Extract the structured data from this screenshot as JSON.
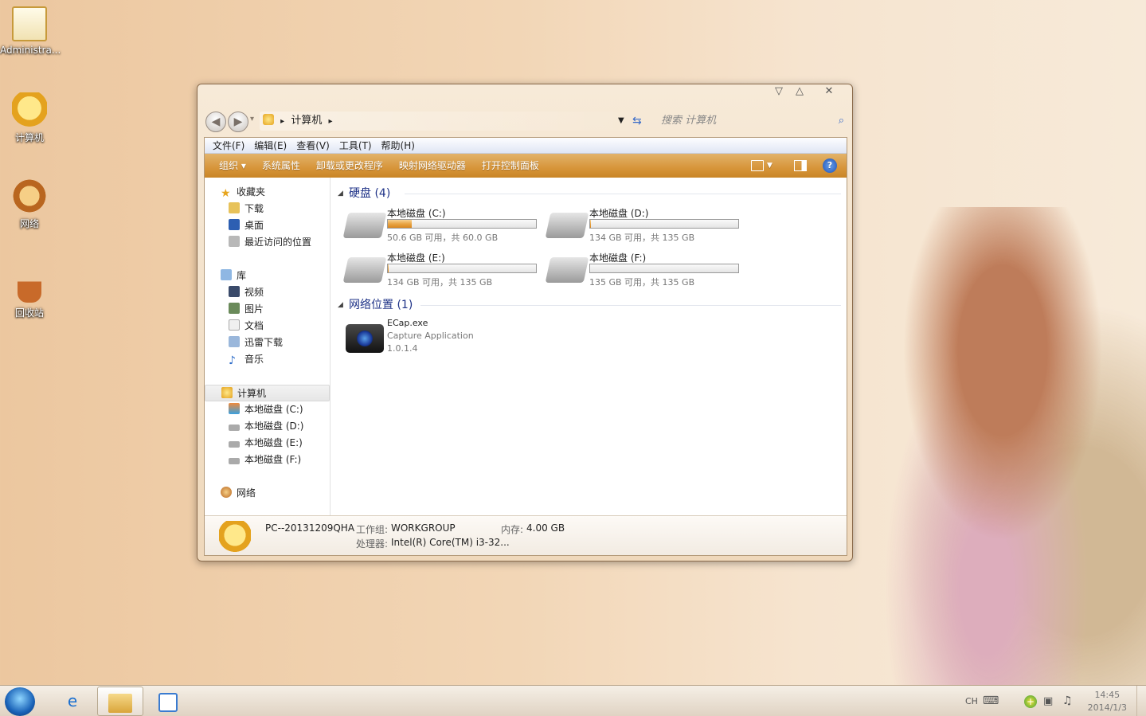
{
  "desktop": {
    "icons": [
      {
        "label": "Administra..."
      },
      {
        "label": "计算机"
      },
      {
        "label": "网络"
      },
      {
        "label": "回收站"
      }
    ]
  },
  "window": {
    "controls": {
      "minimize": "▽",
      "maximize": "△",
      "close": "✕"
    },
    "nav": {
      "back": "◀",
      "forward": "▶",
      "dropdown": "▾"
    },
    "address": {
      "separator": "▸",
      "crumb": "计算机"
    },
    "search": {
      "placeholder": "搜索 计算机"
    },
    "menu": [
      "文件(F)",
      "编辑(E)",
      "查看(V)",
      "工具(T)",
      "帮助(H)"
    ],
    "commands": [
      "组织 ▾",
      "系统属性",
      "卸载或更改程序",
      "映射网络驱动器",
      "打开控制面板"
    ],
    "nav_pane": {
      "favorites": {
        "label": "收藏夹",
        "items": [
          "下载",
          "桌面",
          "最近访问的位置"
        ]
      },
      "libraries": {
        "label": "库",
        "items": [
          "视频",
          "图片",
          "文档",
          "迅雷下载",
          "音乐"
        ]
      },
      "computer": {
        "label": "计算机",
        "items": [
          "本地磁盘 (C:)",
          "本地磁盘 (D:)",
          "本地磁盘 (E:)",
          "本地磁盘 (F:)"
        ]
      },
      "network": {
        "label": "网络"
      }
    },
    "content": {
      "drives_header": "硬盘 (4)",
      "drives": [
        {
          "name": "本地磁盘 (C:)",
          "size": "50.6 GB 可用，共 60.0 GB",
          "used": 0.16
        },
        {
          "name": "本地磁盘 (D:)",
          "size": "134 GB 可用，共 135 GB",
          "used": 0.007
        },
        {
          "name": "本地磁盘 (E:)",
          "size": "134 GB 可用，共 135 GB",
          "used": 0.007
        },
        {
          "name": "本地磁盘 (F:)",
          "size": "135 GB 可用，共 135 GB",
          "used": 0.0
        }
      ],
      "network_header": "网络位置 (1)",
      "network_item": {
        "name": "ECap.exe",
        "desc": "Capture Application",
        "version": "1.0.1.4"
      }
    },
    "details": {
      "pc_name": "PC--20131209QHA",
      "workgroup_label": "工作组:",
      "workgroup": "WORKGROUP",
      "memory_label": "内存:",
      "memory": "4.00 GB",
      "cpu_label": "处理器:",
      "cpu": "Intel(R) Core(TM) i3-32..."
    }
  },
  "taskbar": {
    "lang": "CH",
    "time": "14:45",
    "date": "2014/1/3"
  },
  "colors": {
    "accent": "#d7953a",
    "link": "#1e3287"
  }
}
